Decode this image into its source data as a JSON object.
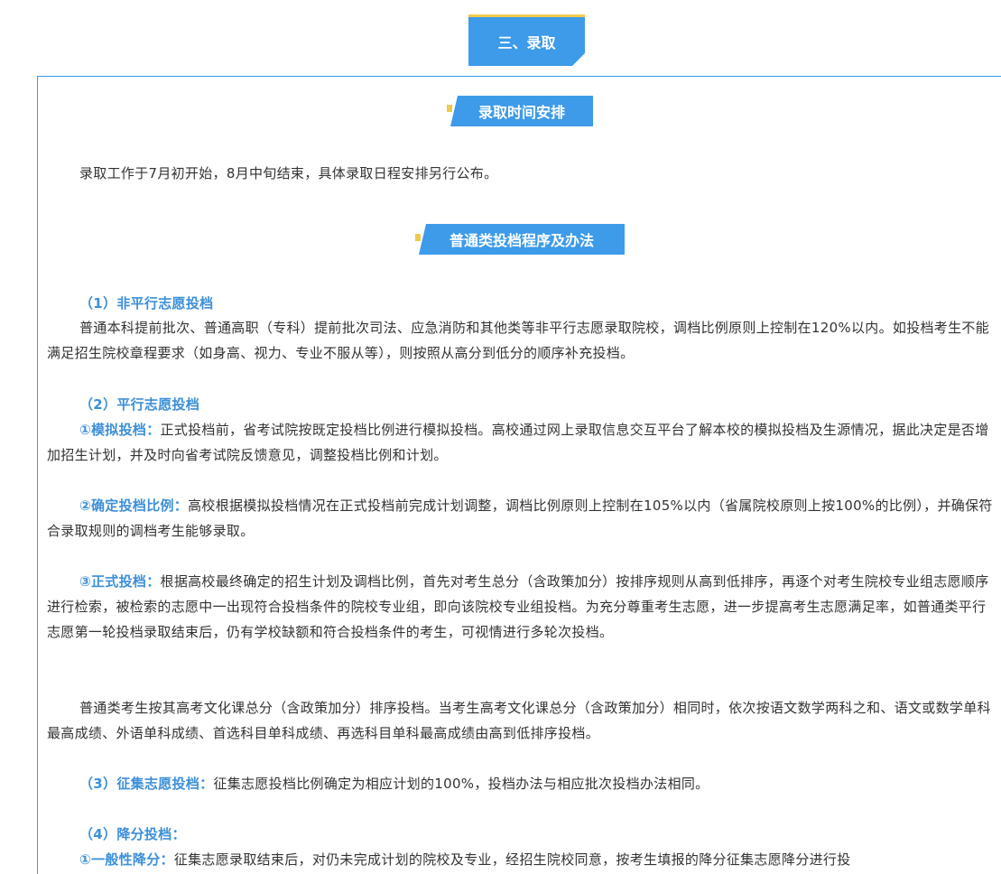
{
  "section_tab": "三、录取",
  "banner1": "录取时间安排",
  "para_time": "录取工作于7月初开始，8月中旬结束，具体录取日程安排另行公布。",
  "banner2": "普通类投档程序及办法",
  "h1": "（1）非平行志愿投档",
  "p1": "普通本科提前批次、普通高职（专科）提前批次司法、应急消防和其他类等非平行志愿录取院校，调档比例原则上控制在120%以内。如投档考生不能满足招生院校章程要求（如身高、视力、专业不服从等），则按照从高分到低分的顺序补充投档。",
  "h2": "（2）平行志愿投档",
  "p2_label": "①模拟投档：",
  "p2": "正式投档前，省考试院按既定投档比例进行模拟投档。高校通过网上录取信息交互平台了解本校的模拟投档及生源情况，据此决定是否增加招生计划，并及时向省考试院反馈意见，调整投档比例和计划。",
  "p3_label": "②确定投档比例：",
  "p3": "高校根据模拟投档情况在正式投档前完成计划调整，调档比例原则上控制在105%以内（省属院校原则上按100%的比例），并确保符合录取规则的调档考生能够录取。",
  "p4_label": "③正式投档：",
  "p4": "根据高校最终确定的招生计划及调档比例，首先对考生总分（含政策加分）按排序规则从高到低排序，再逐个对考生院校专业组志愿顺序进行检索，被检索的志愿中一出现符合投档条件的院校专业组，即向该院校专业组投档。为充分尊重考生志愿，进一步提高考生志愿满足率，如普通类平行志愿第一轮投档录取结束后，仍有学校缺额和符合投档条件的考生，可视情进行多轮次投档。",
  "p5": "普通类考生按其高考文化课总分（含政策加分）排序投档。当考生高考文化课总分（含政策加分）相同时，依次按语文数学两科之和、语文或数学单科最高成绩、外语单科成绩、首选科目单科成绩、再选科目单科最高成绩由高到低排序投档。",
  "h3_label": "（3）征集志愿投档：",
  "p6": "征集志愿投档比例确定为相应计划的100%，投档办法与相应批次投档办法相同。",
  "h4": "（4）降分投档：",
  "p7_label": "①一般性降分：",
  "p7": "征集志愿录取结束后，对仍未完成计划的院校及专业，经招生院校同意，按考生填报的降分征集志愿降分进行投"
}
